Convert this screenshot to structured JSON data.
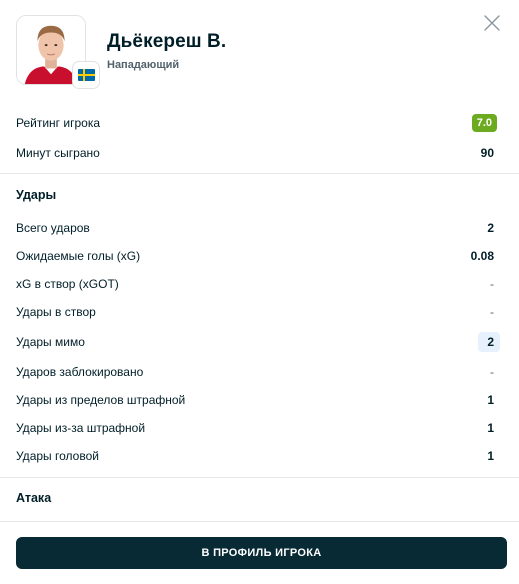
{
  "player": {
    "name": "Дьёкереш В.",
    "position": "Нападающий",
    "flag_icon": "sweden-flag-icon"
  },
  "summary": {
    "rating_label": "Рейтинг игрока",
    "rating_value": "7.0",
    "rating_color": "#6cab1f",
    "minutes_label": "Минут сыграно",
    "minutes_value": "90"
  },
  "shots": {
    "title": "Удары",
    "rows": [
      {
        "label": "Всего ударов",
        "value": "2"
      },
      {
        "label": "Ожидаемые голы (xG)",
        "value": "0.08"
      },
      {
        "label": "xG в створ (xGOT)",
        "value": "-"
      },
      {
        "label": "Удары в створ",
        "value": "-"
      },
      {
        "label": "Удары мимо",
        "value": "2"
      },
      {
        "label": "Ударов заблокировано",
        "value": "-"
      },
      {
        "label": "Удары из пределов штрафной",
        "value": "1"
      },
      {
        "label": "Удары из-за штрафной",
        "value": "1"
      },
      {
        "label": "Удары головой",
        "value": "1"
      }
    ]
  },
  "attack": {
    "title": "Атака"
  },
  "cta": {
    "label": "В ПРОФИЛЬ ИГРОКА"
  }
}
